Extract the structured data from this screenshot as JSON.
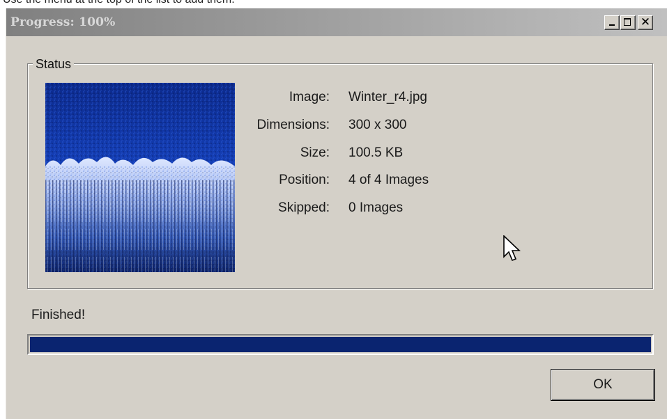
{
  "background_text": "Use the menu at the top of the list to add them.",
  "window": {
    "title": "Progress: 100%",
    "controls": {
      "minimize": "minimize-icon",
      "maximize": "maximize-icon",
      "close": "close-icon"
    }
  },
  "status_group": {
    "legend": "Status",
    "thumbnail_icon": "winter-forest-image",
    "rows": [
      {
        "label": "Image:",
        "value": "Winter_r4.jpg"
      },
      {
        "label": "Dimensions:",
        "value": "300 x 300"
      },
      {
        "label": "Size:",
        "value": "100.5 KB"
      },
      {
        "label": "Position:",
        "value": "4 of 4 Images"
      },
      {
        "label": "Skipped:",
        "value": "0 Images"
      }
    ]
  },
  "progress": {
    "message": "Finished!",
    "value_percent": 100,
    "fill_color": "#0a2470"
  },
  "buttons": {
    "ok_label": "OK"
  },
  "colors": {
    "window_bg": "#d4d0c8",
    "titlebar_inactive": "#808080"
  }
}
